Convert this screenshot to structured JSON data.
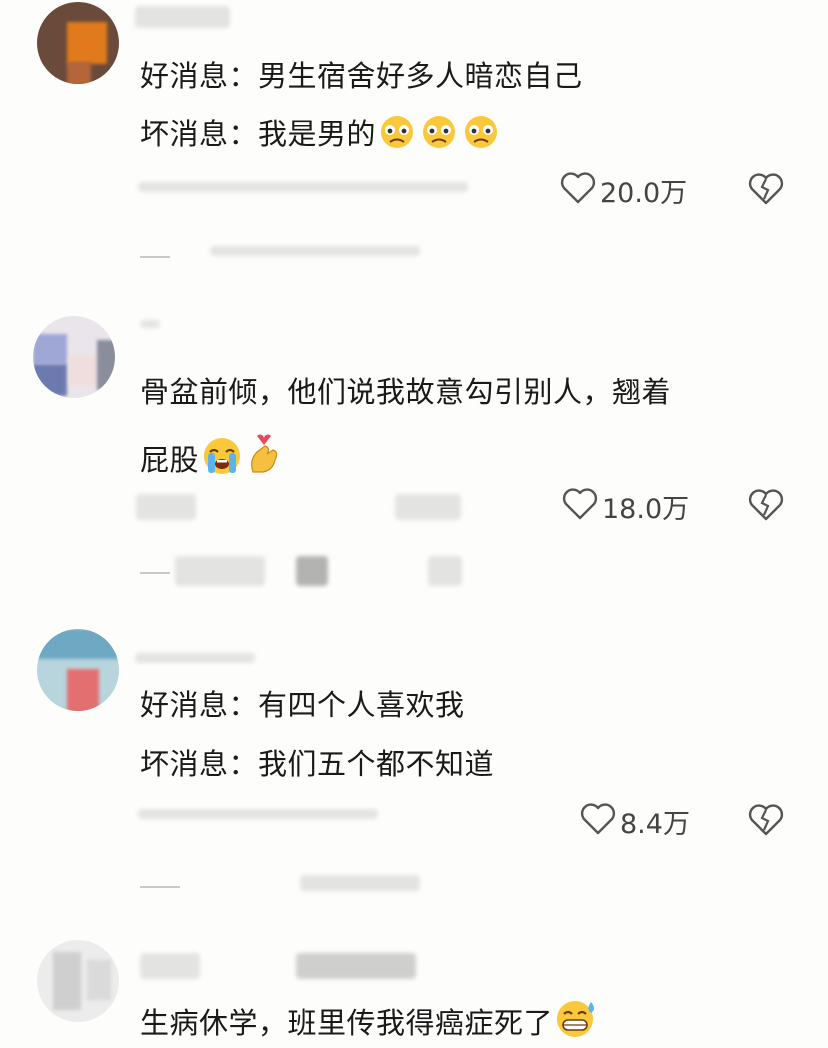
{
  "comments": [
    {
      "lines": [
        "好消息：男生宿舍好多人暗恋自己",
        "坏消息：我是男的"
      ],
      "emojis": [
        "worried-face",
        "worried-face",
        "worried-face"
      ],
      "likes": "20.0万"
    },
    {
      "lines": [
        "骨盆前倾，他们说我故意勾引别人，翘着",
        "屁股"
      ],
      "emojis": [
        "loudly-crying-face",
        "finger-heart"
      ],
      "likes": "18.0万"
    },
    {
      "lines": [
        "好消息：有四个人喜欢我",
        "坏消息：我们五个都不知道"
      ],
      "emojis": [],
      "likes": "8.4万"
    },
    {
      "lines": [
        "生病休学，班里传我得癌症死了"
      ],
      "emojis": [
        "grinning-sweat-face"
      ],
      "likes": ""
    }
  ],
  "colors": {
    "accent_text": "#1a1a1a",
    "meta_text": "#444444",
    "icon": "#555555"
  }
}
